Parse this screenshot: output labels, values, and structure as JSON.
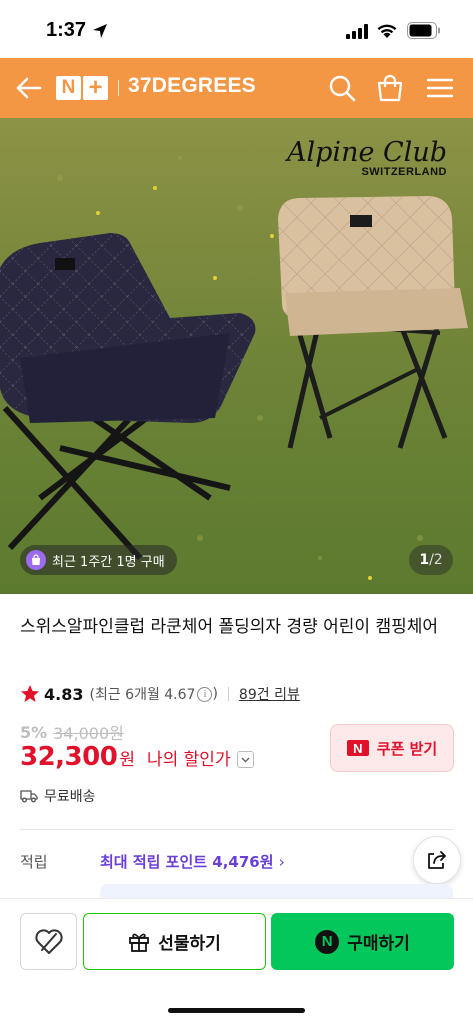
{
  "status_bar": {
    "time": "1:37"
  },
  "header": {
    "logo_n": "N",
    "logo_plus": "+",
    "store_name": "37DEGREES"
  },
  "product_image": {
    "brand_name": "Alpine Club",
    "brand_sub": "SWITZERLAND",
    "purchase_badge": "최근 1주간 1명 구매",
    "page_current": "1",
    "page_total": "/2"
  },
  "product": {
    "title": "스위스알파인클럽 라쿤체어 폴딩의자 경량 어린이 캠핑체어",
    "rating": "4.83",
    "rating_recent": "(최근 6개월 4.67",
    "rating_recent_close": ")",
    "info_symbol": "i",
    "review_count": "89건 리뷰",
    "discount_rate": "5%",
    "original_price": "34,000원",
    "price": "32,300",
    "currency": "원",
    "my_discount_label": "나의 할인가",
    "coupon_badge": "N",
    "coupon_label": "쿠폰 받기",
    "shipping": "무료배송",
    "points_label": "적립",
    "points_value": "최대 적립 포인트 4,476원",
    "points_chevron": "›"
  },
  "bottom_bar": {
    "gift_label": "선물하기",
    "npay_symbol": "N",
    "buy_label": "구매하기"
  },
  "colors": {
    "header": "#f49745",
    "price": "#e1112b",
    "points": "#6a3fd9",
    "buy_button": "#03c75a",
    "gift_border": "#1ec800"
  }
}
